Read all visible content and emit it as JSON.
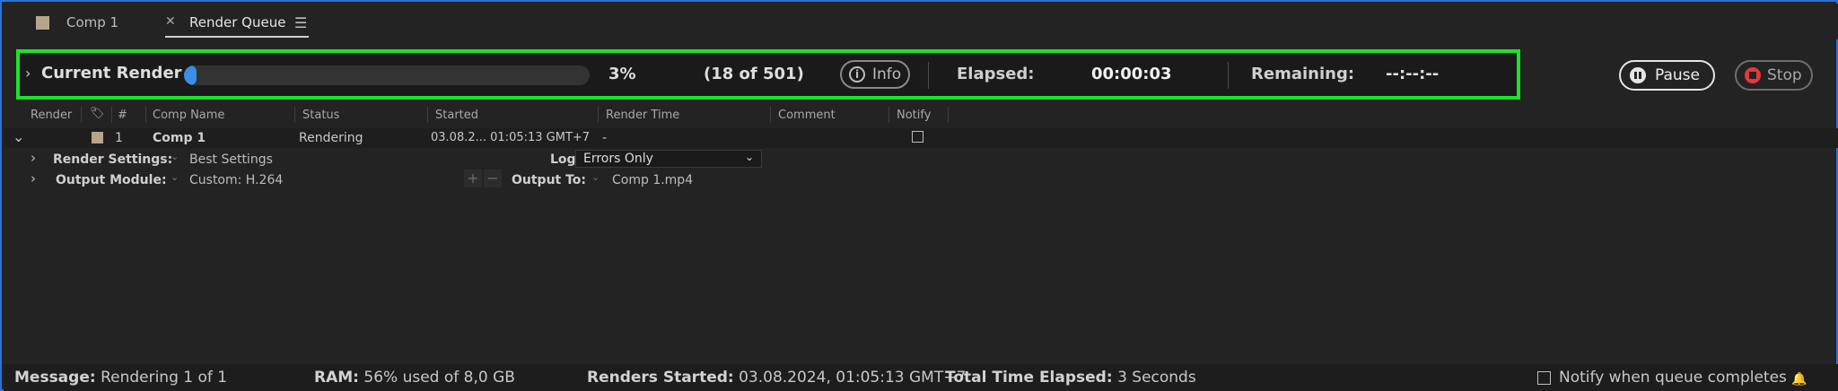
{
  "tabs": [
    {
      "label": "Comp 1",
      "swatch_color": "#b8a48a"
    },
    {
      "label": "Render Queue",
      "active": true
    }
  ],
  "current_render": {
    "title": "Current Render",
    "progress_percent": 3,
    "percent_label": "3%",
    "count_label": "(18 of 501)",
    "info_label": "Info",
    "elapsed_label": "Elapsed:",
    "elapsed_value": "00:00:03",
    "remaining_label": "Remaining:",
    "remaining_value": "--:--:--"
  },
  "controls": {
    "pause_label": "Pause",
    "stop_label": "Stop"
  },
  "table": {
    "columns": [
      "Render",
      "#",
      "Comp Name",
      "Status",
      "Started",
      "Render Time",
      "Comment",
      "Notify"
    ],
    "rows": [
      {
        "number": "1",
        "comp_name": "Comp 1",
        "status": "Rendering",
        "started": "03.08.2... 01:05:13 GMT+7",
        "render_time": "-",
        "label_color": "#b8a48a",
        "render_settings_label": "Render Settings:",
        "render_settings_value": "Best Settings",
        "log_label": "Log:",
        "log_value": "Errors Only",
        "output_module_label": "Output Module:",
        "output_module_value": "Custom: H.264",
        "output_to_label": "Output To:",
        "output_to_value": "Comp 1.mp4"
      }
    ]
  },
  "status_bar": {
    "message_label": "Message:",
    "message_value": "Rendering 1 of 1",
    "ram_label": "RAM:",
    "ram_value": "56% used of 8,0 GB",
    "renders_started_label": "Renders Started:",
    "renders_started_value": "03.08.2024, 01:05:13 GMT+7",
    "total_elapsed_label": "Total Time Elapsed:",
    "total_elapsed_value": "3 Seconds",
    "notify_label": "Notify when queue completes"
  },
  "colors": {
    "accent": "#3a8ee6",
    "highlight_border": "#1be22b",
    "stop": "#e5383b"
  }
}
